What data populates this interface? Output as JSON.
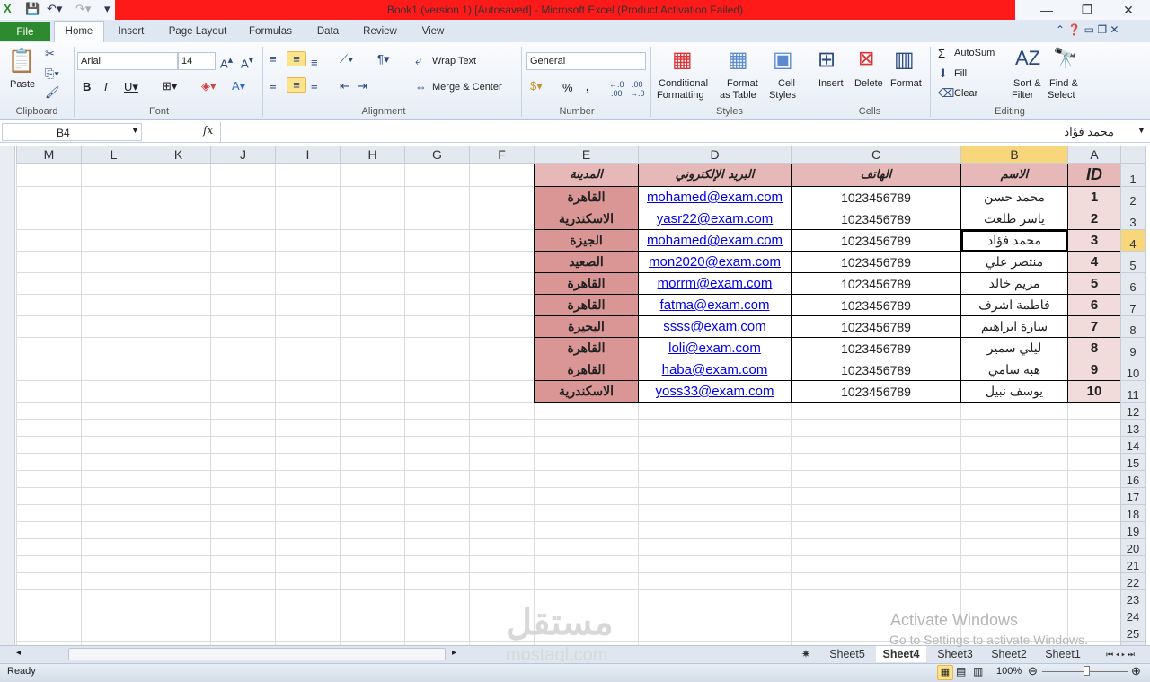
{
  "window": {
    "title": "Book1 (version 1) [Autosaved]  -  Microsoft Excel (Product Activation Failed)"
  },
  "ribbon_tabs": [
    "File",
    "Home",
    "Insert",
    "Page Layout",
    "Formulas",
    "Data",
    "Review",
    "View"
  ],
  "ribbon": {
    "clipboard": {
      "paste": "Paste",
      "group": "Clipboard"
    },
    "font": {
      "name": "Arial",
      "size": "14",
      "group": "Font"
    },
    "alignment": {
      "wrap": "Wrap Text",
      "merge": "Merge & Center",
      "group": "Alignment"
    },
    "number": {
      "format": "General",
      "percent": "%",
      "comma": ",",
      "group": "Number"
    },
    "styles": {
      "conditional": "Conditional",
      "conditional2": "Formatting",
      "format_table": "Format",
      "format_table2": "as Table",
      "cell_styles": "Cell",
      "cell_styles2": "Styles",
      "group": "Styles"
    },
    "cells": {
      "insert": "Insert",
      "delete": "Delete",
      "format": "Format",
      "group": "Cells"
    },
    "editing": {
      "autosum": "AutoSum",
      "fill": "Fill",
      "clear": "Clear",
      "sort": "Sort &",
      "sort2": "Filter",
      "find": "Find &",
      "find2": "Select",
      "group": "Editing"
    }
  },
  "formula_bar": {
    "name_box": "B4",
    "fx": "fx",
    "value": "محمد فؤاد"
  },
  "columns": [
    "A",
    "B",
    "C",
    "D",
    "E",
    "F",
    "G",
    "H",
    "I",
    "J",
    "K",
    "L",
    "M"
  ],
  "selected_column": "B",
  "selected_row": 4,
  "table": {
    "headers": [
      "ID",
      "الاسم",
      "الهاتف",
      "البريد الإلكتروني",
      "المدينة"
    ],
    "rows": [
      [
        "1",
        "محمد حسن",
        "1023456789",
        "mohamed@exam.com",
        "القاهرة"
      ],
      [
        "2",
        "ياسر طلعت",
        "1023456789",
        "yasr22@exam.com",
        "الاسكندرية"
      ],
      [
        "3",
        "محمد فؤاد",
        "1023456789",
        "mohamed@exam.com",
        "الجيزة"
      ],
      [
        "4",
        "منتصر علي",
        "1023456789",
        "mon2020@exam.com",
        "الصعيد"
      ],
      [
        "5",
        "مريم خالد",
        "1023456789",
        "morrm@exam.com",
        "القاهرة"
      ],
      [
        "6",
        "فاطمة اشرف",
        "1023456789",
        "fatma@exam.com",
        "القاهرة"
      ],
      [
        "7",
        "سارة ابراهيم",
        "1023456789",
        "ssss@exam.com",
        "البحيرة"
      ],
      [
        "8",
        "ليلي سمير",
        "1023456789",
        "loli@exam.com",
        "القاهرة"
      ],
      [
        "9",
        "هبة سامي",
        "1023456789",
        "haba@exam.com",
        "القاهرة"
      ],
      [
        "10",
        "يوسف نبيل",
        "1023456789",
        "yoss33@exam.com",
        "الاسكندرية"
      ]
    ]
  },
  "row_count": 26,
  "sheet_tabs": [
    "Sheet5",
    "Sheet4",
    "Sheet3",
    "Sheet2",
    "Sheet1"
  ],
  "active_sheet": "Sheet4",
  "status": {
    "ready": "Ready",
    "zoom": "100%"
  },
  "watermark": {
    "line1": "Activate Windows",
    "line2": "Go to Settings to activate Windows.",
    "logo": "مستقل",
    "logo_sub": "mostaql.com"
  },
  "colors": {
    "title_red": "#ff1a1a",
    "header_fill": "#e6b8b7",
    "id_fill": "#f2dcdb",
    "city_fill": "#da9694",
    "link": "#0000ee"
  }
}
